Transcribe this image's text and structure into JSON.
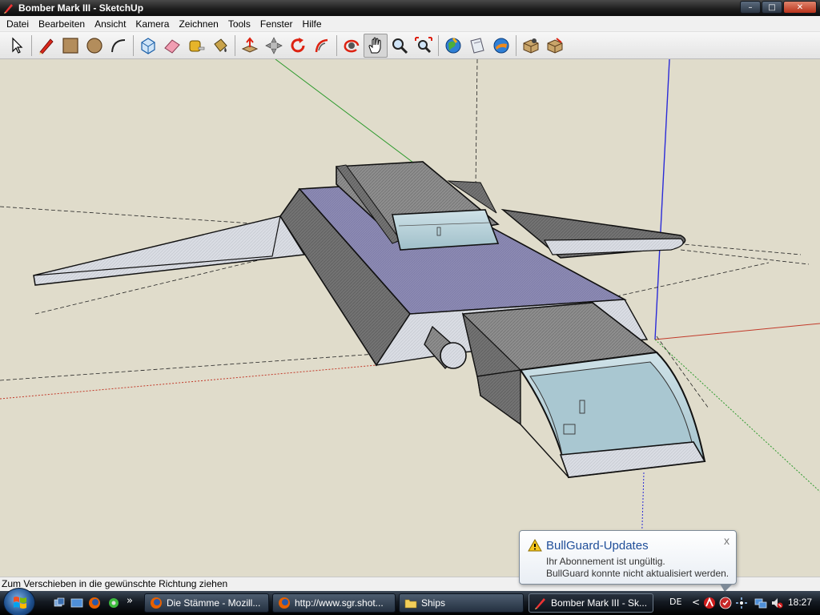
{
  "window": {
    "title": "Bomber Mark III - SketchUp",
    "controls": {
      "minimize": "–",
      "maximize": "□",
      "close": "✕"
    }
  },
  "menu": [
    "Datei",
    "Bearbeiten",
    "Ansicht",
    "Kamera",
    "Zeichnen",
    "Tools",
    "Fenster",
    "Hilfe"
  ],
  "toolbar": {
    "tools": [
      "select-icon",
      "pencil-icon",
      "rectangle-icon",
      "circle-icon",
      "arc-icon",
      "make-component-icon",
      "eraser-icon",
      "tape-measure-icon",
      "paint-bucket-icon",
      "push-pull-icon",
      "move-icon",
      "rotate-icon",
      "follow-me-icon",
      "orbit-icon",
      "pan-icon",
      "zoom-icon",
      "zoom-extents-icon",
      "get-models-icon",
      "share-model-icon",
      "google-earth-icon",
      "component-icon",
      "warehouse-icon"
    ],
    "active_tool": "pan-icon"
  },
  "viewport": {
    "background": "#e0dccb",
    "axis_colors": {
      "red": "#c23a2a",
      "green": "#2e9a2e",
      "blue": "#2b2bd8"
    }
  },
  "status": {
    "text": "Zum Verschieben in die gewünschte Richtung ziehen"
  },
  "notification": {
    "title": "BullGuard-Updates",
    "lines": [
      "Ihr Abonnement ist ungültig.",
      "BullGuard konnte nicht aktualisiert werden."
    ],
    "close": "x",
    "icon": "warning-icon"
  },
  "taskbar": {
    "more_label": "»",
    "tasks": [
      {
        "label": "Die Stämme - Mozill...",
        "icon": "firefox-icon",
        "active": false
      },
      {
        "label": "http://www.sgr.shot...",
        "icon": "firefox-icon",
        "active": false
      },
      {
        "label": "Ships",
        "icon": "folder-icon",
        "active": false
      },
      {
        "label": "Bomber Mark III - Sk...",
        "icon": "sketchup-icon",
        "active": true
      }
    ],
    "tray": {
      "language": "DE",
      "clock": "18:27",
      "expand": "<"
    }
  }
}
